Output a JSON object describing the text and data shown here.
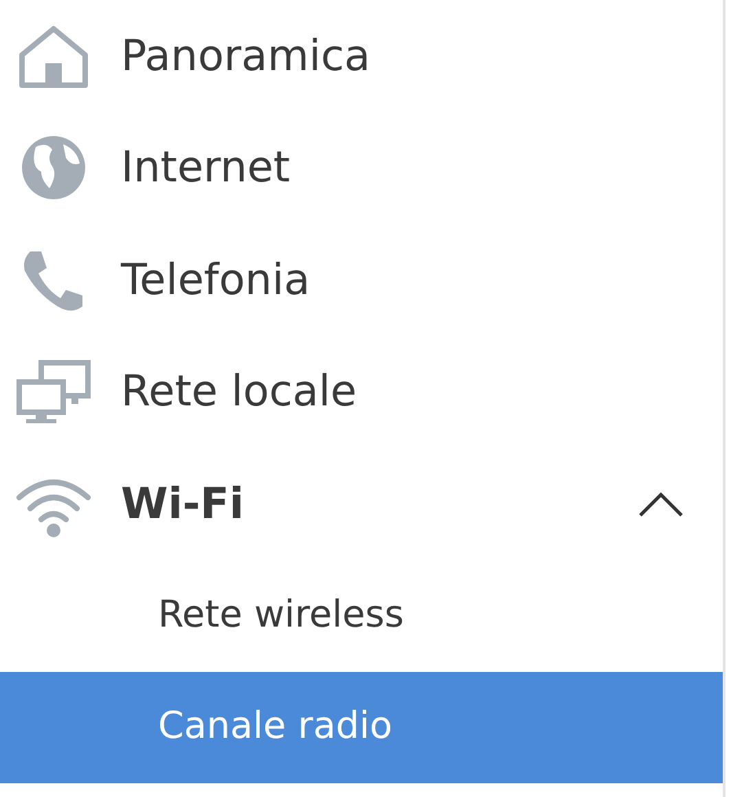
{
  "menu": [
    {
      "label": "Panoramica",
      "kind": "home",
      "expanded": false
    },
    {
      "label": "Internet",
      "kind": "globe",
      "expanded": false
    },
    {
      "label": "Telefonia",
      "kind": "phone",
      "expanded": false
    },
    {
      "label": "Rete locale",
      "kind": "network",
      "expanded": false
    },
    {
      "label": "Wi-Fi",
      "kind": "wifi",
      "expanded": true,
      "children": [
        {
          "label": "Rete wireless",
          "selected": false
        },
        {
          "label": "Canale radio",
          "selected": true
        }
      ]
    }
  ]
}
